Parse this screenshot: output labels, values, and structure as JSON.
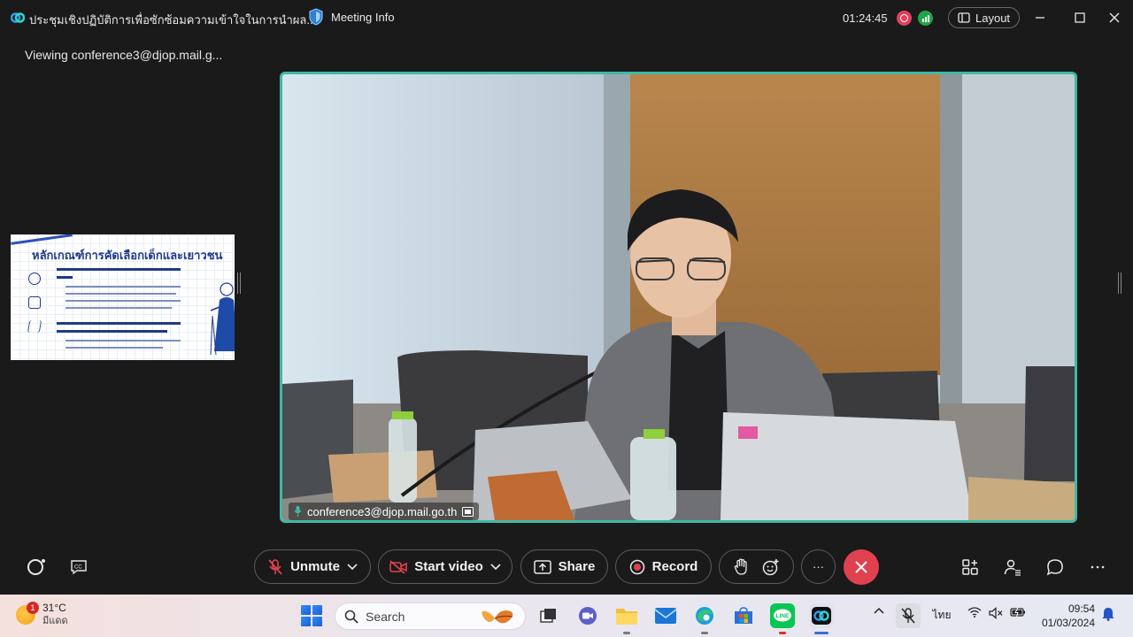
{
  "window": {
    "title": "ประชุมเชิงปฏิบัติการเพื่อซักซ้อมความเข้าใจในการนำผล...",
    "meeting_info_label": "Meeting Info",
    "elapsed_time": "01:24:45",
    "layout_label": "Layout"
  },
  "viewing_label": "Viewing conference3@djop.mail.g...",
  "slide": {
    "title": "หลักเกณฑ์การคัดเลือกเด็กและเยาวชน"
  },
  "video": {
    "participant_name": "conference3@djop.mail.go.th"
  },
  "controls": {
    "unmute_label": "Unmute",
    "start_video_label": "Start video",
    "share_label": "Share",
    "record_label": "Record",
    "more_label": "···"
  },
  "taskbar": {
    "weather_temp": "31°C",
    "weather_condition": "มีแดด",
    "weather_badge": "1",
    "search_placeholder": "Search",
    "language": "ไทย",
    "time": "09:54",
    "date": "01/03/2024"
  },
  "colors": {
    "active_speaker_border": "#3fb9a4",
    "end_call": "#e0414e",
    "recording": "#e0415a",
    "network_good": "#1fa64a"
  }
}
